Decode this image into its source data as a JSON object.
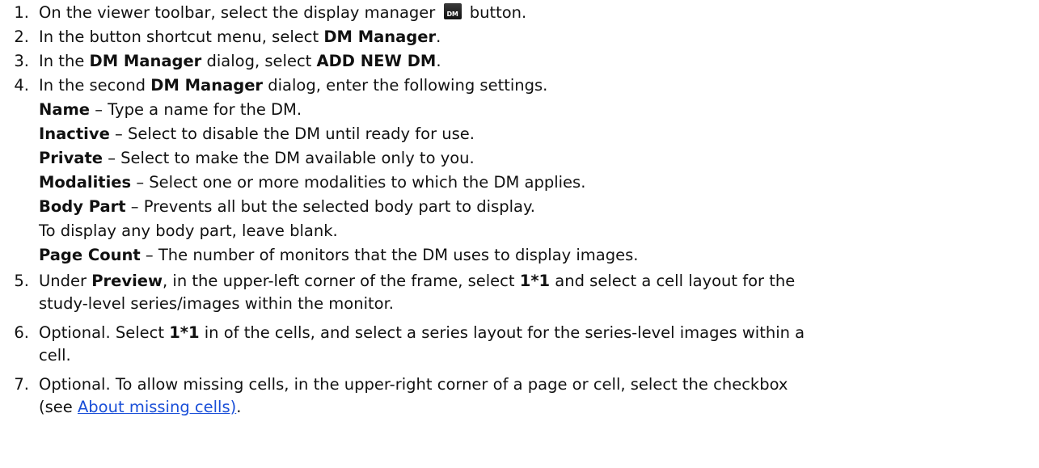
{
  "steps": [
    {
      "num": "1.",
      "a": "On the viewer toolbar, select the display manager",
      "icon": "DM",
      "b": "button."
    },
    {
      "num": "2.",
      "a": "In the button shortcut menu, select ",
      "b1": "DM Manager",
      "c": "."
    },
    {
      "num": "3.",
      "a": "In the ",
      "b1": "DM Manager",
      "c": " dialog, select ",
      "b2": "ADD NEW DM",
      "d": "."
    },
    {
      "num": "4.",
      "a": "In the second ",
      "b1": "DM Manager",
      "c": " dialog, enter the following settings."
    },
    {
      "num": "5.",
      "a": "Under ",
      "b1": "Preview",
      "c": ", in the upper-left corner of the frame, select ",
      "b2": "1*1",
      "d": " and select a cell layout for the",
      "line2": "study-level series/images within the monitor."
    },
    {
      "num": "6.",
      "a": "Optional. Select ",
      "b1": "1*1",
      "c": " in of the cells, and select a series layout for the series-level images within a",
      "line2": "cell."
    },
    {
      "num": "7.",
      "a": "Optional. To allow missing cells, in the upper-right corner of a page or cell, select the checkbox",
      "line2a": "(see ",
      "link": "About missing cells)",
      "line2b": "."
    }
  ],
  "settings": [
    {
      "term": "Name",
      "desc": " – Type a name for the DM."
    },
    {
      "term": "Inactive",
      "desc": " – Select to disable the DM until ready for use."
    },
    {
      "term": "Private",
      "desc": " – Select to make the DM available only to you."
    },
    {
      "term": "Modalities",
      "desc": " – Select one or more modalities to which the DM applies."
    },
    {
      "term": "Body Part",
      "desc": " – Prevents all but the selected body part to display."
    },
    {
      "term": "",
      "desc": "To display any body part, leave blank."
    },
    {
      "term": "Page Count",
      "desc": " – The number of monitors that the DM uses to display images."
    }
  ]
}
